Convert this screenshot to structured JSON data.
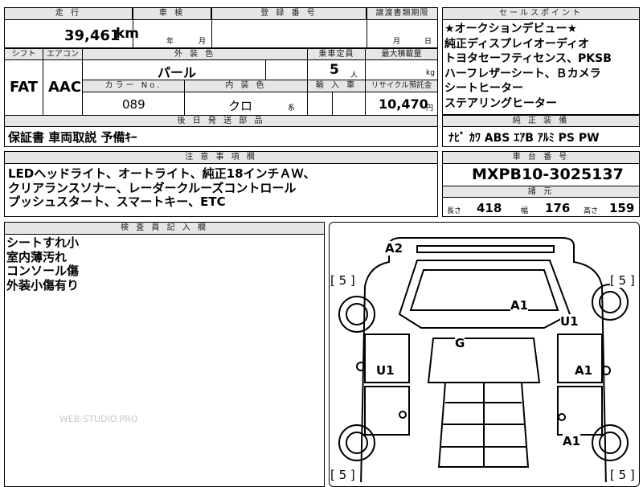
{
  "top": {
    "mileage_label": "走 行",
    "mileage_value": "39,461",
    "mileage_unit": "km",
    "inspection_label": "車 検",
    "inspection_year": "年",
    "inspection_month": "月",
    "registration_label": "登 録 番 号",
    "transfer_label": "譲渡書類期限",
    "transfer_month": "月",
    "transfer_day": "日"
  },
  "specs": {
    "shift_label": "シフト",
    "shift_value": "FAT",
    "ac_label": "エアコン",
    "ac_value": "AAC",
    "exterior_color_label": "外 装 色",
    "exterior_color_value": "パール",
    "capacity_label": "乗車定員",
    "capacity_value": "5",
    "capacity_unit": "人",
    "load_label": "最大積載量",
    "load_unit": "kg",
    "color_no_label": "カラー No.",
    "color_no_value": "089",
    "interior_color_label": "内 装 色",
    "interior_color_value": "クロ",
    "interior_color_suffix": "系",
    "import_label": "輸 入 車",
    "recycle_label": "リサイクル預託金",
    "recycle_value": "10,470",
    "recycle_unit": "円"
  },
  "after_parts": {
    "label": "後 日 発 送 部 品",
    "value": "保証書 車両取説 予備ｷｰ"
  },
  "notes": {
    "label": "注 意 事 項 欄",
    "lines": [
      "LEDヘッドライト、オートライト、純正18インチＡＷ、",
      "クリアランスソナー、レーダークルーズコントロール",
      "プッシュスタート、スマートキー、ETC"
    ]
  },
  "sales_points": {
    "label": "セールスポイント",
    "lines": [
      "★オークションデビュー★",
      "純正ディスプレイオーディオ",
      "トヨタセーフティセンス、PKSB",
      "ハーフレザーシート、Ｂカメラ",
      "シートヒーター",
      "ステアリングヒーター"
    ]
  },
  "equipment": {
    "label": "純 正 装 備",
    "value": "ﾅﾋﾞ ｶﾜ ABS ｴｱB ｱﾙﾐ PS PW"
  },
  "chassis": {
    "label": "車 台 番 号",
    "value": "MXPB10-3025137"
  },
  "dimensions": {
    "label": "諸 元",
    "length_label": "長さ",
    "length_value": "418",
    "width_label": "幅",
    "width_value": "176",
    "height_label": "高さ",
    "height_value": "159"
  },
  "inspector": {
    "label": "検 査 員 記 入 欄",
    "lines": [
      "シートすれ小",
      "室内薄汚れ",
      "コンソール傷",
      "外装小傷有り"
    ]
  },
  "watermark": "WEB-STUDIO.PRO",
  "diagram": {
    "marks": [
      {
        "text": "A2"
      },
      {
        "text": "A1"
      },
      {
        "text": "U1"
      },
      {
        "text": "G"
      },
      {
        "text": "U1"
      },
      {
        "text": "A1"
      },
      {
        "text": "A1"
      }
    ],
    "tires": [
      {
        "text": "[ 5 ]"
      },
      {
        "text": "[ 5 ]"
      },
      {
        "text": "[ 5 ]"
      },
      {
        "text": "[ 5 ]"
      }
    ]
  }
}
